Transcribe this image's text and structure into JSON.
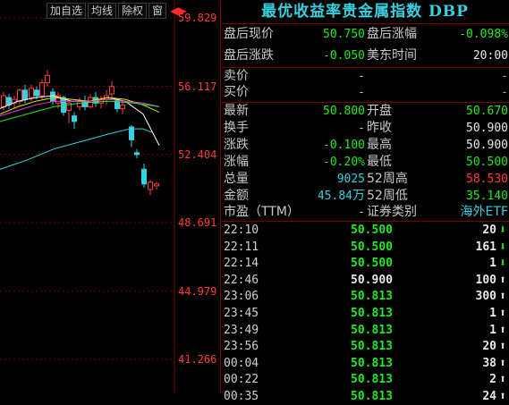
{
  "toolbar": {
    "add": "加自选",
    "ma": "均线",
    "exright": "除权",
    "window": "窗"
  },
  "yaxis": [
    "59.829",
    "56.117",
    "52.404",
    "48.691",
    "44.979",
    "41.266"
  ],
  "title": "最优收益率贵金属指数 DBP",
  "quote": {
    "after_price_label": "盘后现价",
    "after_price": "50.750",
    "after_pct_label": "盘后涨幅",
    "after_pct": "-0.098%",
    "after_chg_label": "盘后涨跌",
    "after_chg": "-0.050",
    "us_time_label": "美东时间",
    "us_time": "20:00",
    "sell_label": "卖价",
    "sell_val": "-",
    "sell_vol": "-",
    "buy_label": "买价",
    "buy_val": "-",
    "buy_vol": "-",
    "last_label": "最新",
    "last": "50.800",
    "open_label": "开盘",
    "open": "50.670",
    "turnover_label": "换手",
    "turnover": "-",
    "prev_label": "昨收",
    "prev": "50.900",
    "chg_label": "涨跌",
    "chg": "-0.100",
    "high_label": "最高",
    "high": "50.900",
    "pct_label": "涨幅",
    "pct": "-0.20%",
    "low_label": "最低",
    "low": "50.500",
    "vol_label": "总量",
    "vol": "9025",
    "w52h_label": "52周高",
    "w52h": "58.530",
    "amt_label": "金额",
    "amt": "45.84",
    "amt_unit": "万",
    "w52l_label": "52周低",
    "w52l": "35.140",
    "pe_label": "市盈（TTM）",
    "pe": "-",
    "cat_label": "证券类别",
    "cat": "海外ETF"
  },
  "ticks": [
    {
      "time": "22:10",
      "price": "50.500",
      "vol": "20",
      "dir": "down"
    },
    {
      "time": "22:11",
      "price": "50.500",
      "vol": "161",
      "dir": "down"
    },
    {
      "time": "22:14",
      "price": "50.500",
      "vol": "1",
      "dir": "down"
    },
    {
      "time": "22:46",
      "price": "50.900",
      "vol": "100",
      "dir": "up"
    },
    {
      "time": "23:06",
      "price": "50.813",
      "vol": "300",
      "dir": "up"
    },
    {
      "time": "23:45",
      "price": "50.813",
      "vol": "1",
      "dir": "up"
    },
    {
      "time": "23:49",
      "price": "50.813",
      "vol": "1",
      "dir": "up"
    },
    {
      "time": "23:56",
      "price": "50.813",
      "vol": "20",
      "dir": "up"
    },
    {
      "time": "00:04",
      "price": "50.813",
      "vol": "38",
      "dir": "up"
    },
    {
      "time": "00:22",
      "price": "50.813",
      "vol": "2",
      "dir": "up"
    },
    {
      "time": "00:35",
      "price": "50.813",
      "vol": "24",
      "dir": "up"
    }
  ],
  "colors": {
    "up": "#ff3b3b",
    "down": "#22e822",
    "grid": "#7a0000",
    "cyan": "#38d0e0"
  }
}
